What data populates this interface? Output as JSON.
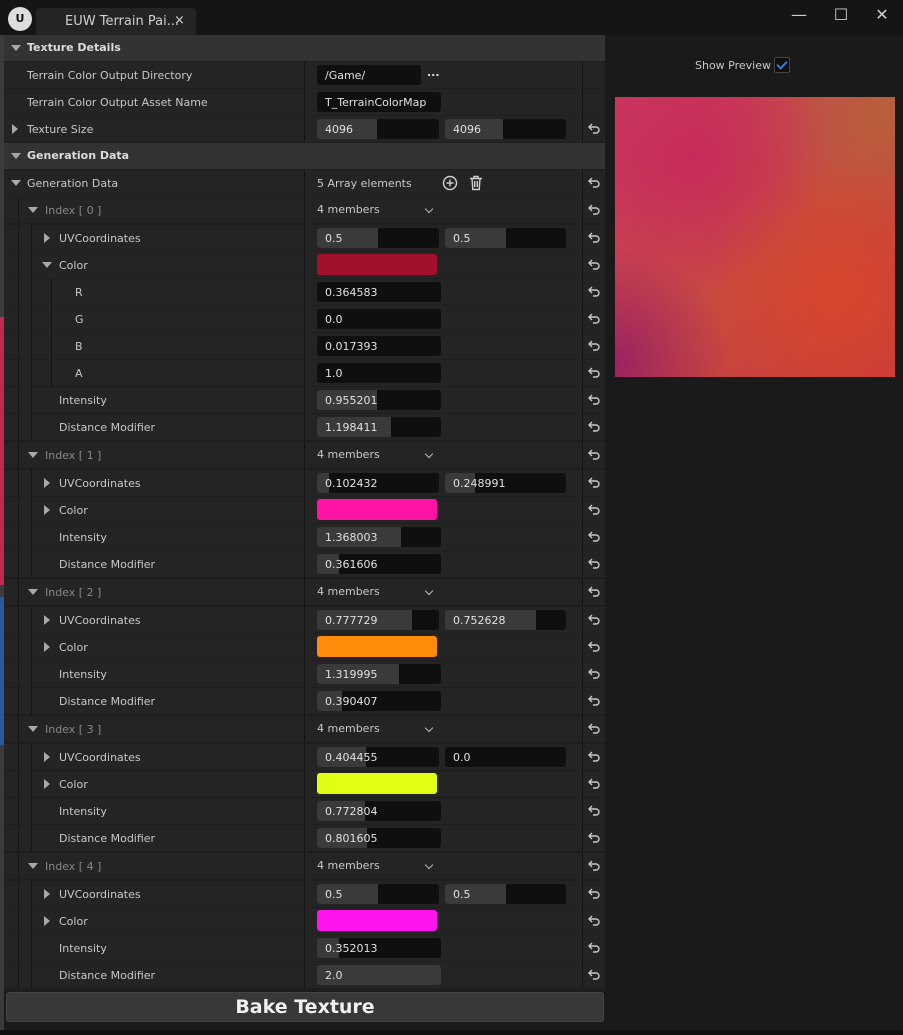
{
  "window": {
    "tab_title": "EUW Terrain Pai...",
    "tab_close": "×",
    "minimize": "—",
    "maximize": "☐",
    "close": "✕"
  },
  "texture_details": {
    "header": "Texture Details",
    "output_dir_label": "Terrain Color Output Directory",
    "output_dir_value": "/Game/",
    "browse": "...",
    "asset_name_label": "Terrain Color Output Asset Name",
    "asset_name_value": "T_TerrainColorMap",
    "size_label": "Texture Size",
    "size_x": "4096",
    "size_y": "4096"
  },
  "generation": {
    "header": "Generation Data",
    "array_label": "Generation Data",
    "array_count": "5 Array elements",
    "uv_label": "UVCoordinates",
    "color_label": "Color",
    "intensity_label": "Intensity",
    "distance_label": "Distance Modifier",
    "r_label": "R",
    "g_label": "G",
    "b_label": "B",
    "a_label": "A",
    "items": [
      {
        "index": "Index [ 0 ]",
        "members": "4 members",
        "uv_x": "0.5",
        "uv_y": "0.5",
        "uv_x_fill": 0.5,
        "uv_y_fill": 0.5,
        "color": "#a3102c",
        "r": "0.364583",
        "g": "0.0",
        "b": "0.017393",
        "a": "1.0",
        "intensity": "0.955201",
        "intensity_fill": 0.48,
        "distance": "1.198411",
        "distance_fill": 0.6
      },
      {
        "index": "Index [ 1 ]",
        "members": "4 members",
        "uv_x": "0.102432",
        "uv_y": "0.248991",
        "uv_x_fill": 0.1,
        "uv_y_fill": 0.25,
        "color": "#ff12a4",
        "intensity": "1.368003",
        "intensity_fill": 0.68,
        "distance": "0.361606",
        "distance_fill": 0.18
      },
      {
        "index": "Index [ 2 ]",
        "members": "4 members",
        "uv_x": "0.777729",
        "uv_y": "0.752628",
        "uv_x_fill": 0.78,
        "uv_y_fill": 0.75,
        "color": "#ff8c0a",
        "intensity": "1.319995",
        "intensity_fill": 0.66,
        "distance": "0.390407",
        "distance_fill": 0.2
      },
      {
        "index": "Index [ 3 ]",
        "members": "4 members",
        "uv_x": "0.404455",
        "uv_y": "0.0",
        "uv_x_fill": 0.4,
        "uv_y_fill": 0.0,
        "color": "#e0ff14",
        "intensity": "0.772804",
        "intensity_fill": 0.39,
        "distance": "0.801605",
        "distance_fill": 0.4
      },
      {
        "index": "Index [ 4 ]",
        "members": "4 members",
        "uv_x": "0.5",
        "uv_y": "0.5",
        "uv_x_fill": 0.5,
        "uv_y_fill": 0.5,
        "color": "#ff14f0",
        "intensity": "0.352013",
        "intensity_fill": 0.18,
        "distance": "2.0",
        "distance_fill": 1.0
      }
    ]
  },
  "bake_button": "Bake Texture",
  "preview": {
    "label": "Show Preview",
    "checked": true
  }
}
